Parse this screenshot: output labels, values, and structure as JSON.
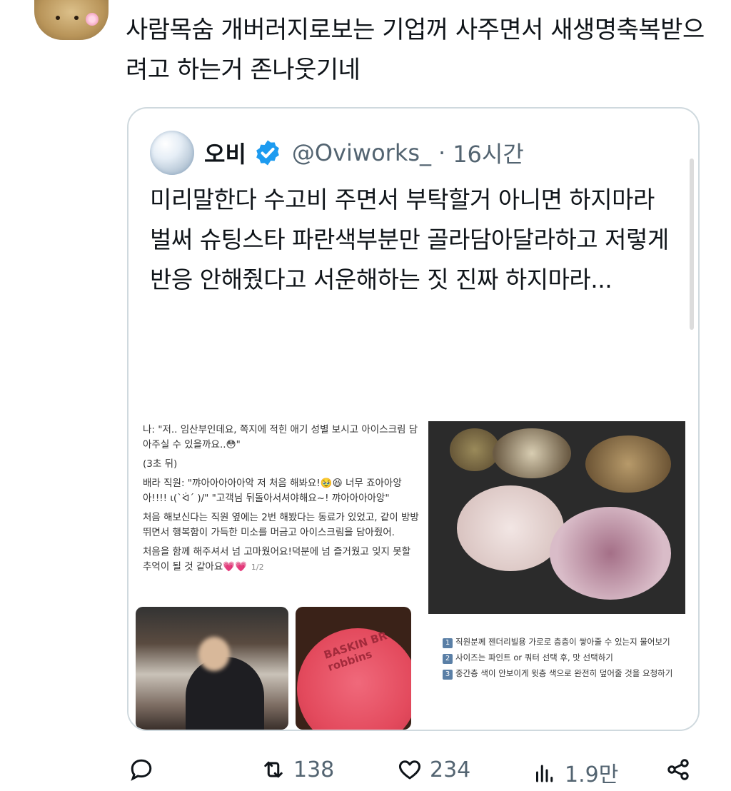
{
  "post": {
    "text": "사람목숨 개버러지로보는 기업꺼 사주면서 새생명축복받으려고 하는거 존나웃기네"
  },
  "quote": {
    "name": "오비",
    "handle": "@Oviworks_",
    "dot": "·",
    "time": "16시간",
    "text_lines": [
      "미리말한다 수고비 주면서 부탁할거 아니면 하지마라",
      "벌써 슈팅스타 파란색부분만 골라담아달라하고 저렇게 반응 안해줬다고 서운해하는 짓 진짜 하지마라..."
    ],
    "image_left": {
      "p1": "나: \"저.. 임산부인데요, 쪽지에 적힌 애기 성별 보시고 아이스크림 담아주실 수 있을까요..😳\"",
      "p2": "(3초 뒤)",
      "p3": "배라 직원: \"꺄아아아아아악 저 처음 해봐요!🥹😆 너무 죠아아앙아!!!! ι(`ᐛ´ )/\" \"고객님 뒤돌아서셔야해요~! 꺄아아아아앙\"",
      "p4": "처음 해보신다는 직원 옆에는 2번 해봤다는 동료가 있었고, 같이 방방뛰면서 행복함이 가득한 미소를 머금고 아이스크림을 담아줬어.",
      "p5": "처음을 함께 해주셔서 넘 고마웠어요!덕분에 넘 즐거웠고 잊지 못할 추억이 될 것 같아요💗💗",
      "page": "1/2",
      "lid_text": "BASKIN BR robbins"
    },
    "image_right": {
      "steps": [
        "직원분께 젠더리빌용 가로로 층층이 쌓아줄 수 있는지 물어보기",
        "사이즈는 파인트 or 쿼터 선택 후, 맛 선택하기",
        "중간층 색이 안보이게 윗층 색으로 완전히 덮어줄 것을 요청하기"
      ],
      "step_nums": [
        "1",
        "2",
        "3"
      ]
    }
  },
  "actions": {
    "reply": "",
    "retweets": "138",
    "likes": "234",
    "views": "1.9만"
  },
  "colors": {
    "verified": "#1d9bf0",
    "muted": "#536471",
    "border": "#cfd9de"
  }
}
